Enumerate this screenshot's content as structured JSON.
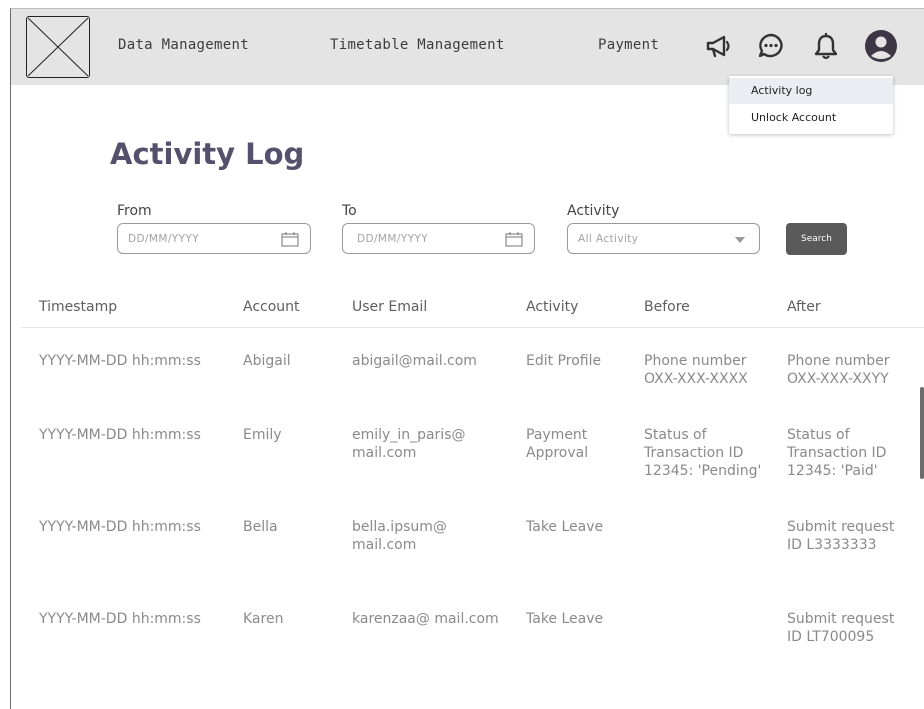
{
  "nav": {
    "items": [
      "Data Management",
      "Timetable Management",
      "Payment"
    ],
    "icons": [
      "megaphone-icon",
      "chat-bubble-icon",
      "bell-icon",
      "user-circle-icon"
    ]
  },
  "dropdown": {
    "items": [
      "Activity log",
      "Unlock Account"
    ]
  },
  "page": {
    "title": "Activity Log"
  },
  "filters": {
    "from_label": "From",
    "from_placeholder": "DD/MM/YYYY",
    "to_label": "To",
    "to_placeholder": "DD/MM/YYYY",
    "activity_label": "Activity",
    "activity_value": "All Activity",
    "search_label": "Search"
  },
  "table": {
    "headers": [
      "Timestamp",
      "Account",
      "User Email",
      "Activity",
      "Before",
      "After"
    ],
    "rows": [
      {
        "timestamp": "YYYY-MM-DD hh:mm:ss",
        "account": "Abigail",
        "email": "abigail@mail.com",
        "activity": "Edit Profile",
        "before": "Phone number\nOXX-XXX-XXXX",
        "after": "Phone number\nOXX-XXX-XXYY"
      },
      {
        "timestamp": "YYYY-MM-DD hh:mm:ss",
        "account": "Emily",
        "email": "emily_in_paris@\nmail.com",
        "activity": "Payment\nApproval",
        "before": "Status of\nTransaction ID\n12345: 'Pending'",
        "after": "Status of\nTransaction ID\n12345: 'Paid'"
      },
      {
        "timestamp": "YYYY-MM-DD hh:mm:ss",
        "account": "Bella",
        "email": "bella.ipsum@\nmail.com",
        "activity": "Take Leave",
        "before": "",
        "after": "Submit request\nID L3333333"
      },
      {
        "timestamp": "YYYY-MM-DD hh:mm:ss",
        "account": "Karen",
        "email": "karenzaa@ mail.com",
        "activity": "Take Leave",
        "before": "",
        "after": "Submit request\nID LT700095"
      }
    ]
  }
}
